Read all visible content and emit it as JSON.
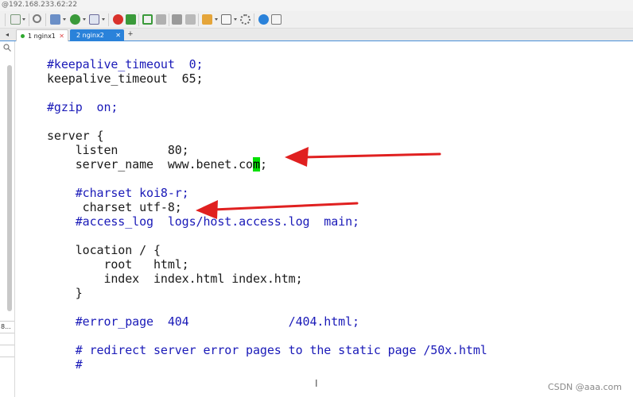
{
  "window": {
    "title": "@192.168.233.62:22"
  },
  "toolbar": {
    "icons": [
      "new-session-icon",
      "open-folder-icon",
      "find-icon",
      "properties-icon",
      "globe-icon",
      "compose-icon",
      "record-icon",
      "sftp-icon",
      "fullscreen-icon",
      "transfer-icon",
      "lock-icon",
      "keyboard-icon",
      "edit-icon",
      "folder-icon",
      "layout-icon",
      "settings-icon",
      "help-icon",
      "chat-icon"
    ],
    "colors": {
      "green": "#3a9a3a",
      "blue": "#2a82da",
      "red": "#d9312b",
      "gray": "#7a7a7a"
    }
  },
  "tabs": [
    {
      "label": "1 nginx1",
      "active": false
    },
    {
      "label": "2 nginx2",
      "active": true
    }
  ],
  "tab_add_label": "+",
  "tab_nav_label": "◂",
  "left_panel": {
    "cells": [
      "8...",
      "",
      "",
      ""
    ]
  },
  "editor": {
    "lines": [
      {
        "text": "#keepalive_timeout  0;",
        "type": "comment"
      },
      {
        "text": "keepalive_timeout  65;",
        "type": "code"
      },
      {
        "text": "",
        "type": "code"
      },
      {
        "text": "#gzip  on;",
        "type": "comment"
      },
      {
        "text": "",
        "type": "code"
      },
      {
        "text": "server {",
        "type": "code"
      },
      {
        "text": "    listen       80;",
        "type": "code"
      },
      {
        "text": "    server_name  www.benet.co",
        "cursor": "m",
        "after": ";",
        "type": "code"
      },
      {
        "text": "",
        "type": "code"
      },
      {
        "text": "    #charset koi8-r;",
        "type": "comment"
      },
      {
        "text": "     charset utf-8;",
        "type": "code"
      },
      {
        "text": "    #access_log  logs/host.access.log  main;",
        "type": "comment"
      },
      {
        "text": "",
        "type": "code"
      },
      {
        "text": "    location / {",
        "type": "code"
      },
      {
        "text": "        root   html;",
        "type": "code"
      },
      {
        "text": "        index  index.html index.htm;",
        "type": "code"
      },
      {
        "text": "    }",
        "type": "code"
      },
      {
        "text": "",
        "type": "code"
      },
      {
        "text": "    #error_page  404              /404.html;",
        "type": "comment"
      },
      {
        "text": "",
        "type": "code"
      },
      {
        "text": "    # redirect server error pages to the static page /50x.html",
        "type": "comment"
      },
      {
        "text": "    #",
        "type": "comment"
      }
    ],
    "colors": {
      "code": "#1a1a1a",
      "comment": "#1a1ab8",
      "cursor_bg": "#00e000"
    }
  },
  "annotations": {
    "arrow_color": "#e02020",
    "arrow_count": 2
  },
  "status": {
    "ibeam": "I"
  },
  "watermark": "CSDN @aaa.com"
}
